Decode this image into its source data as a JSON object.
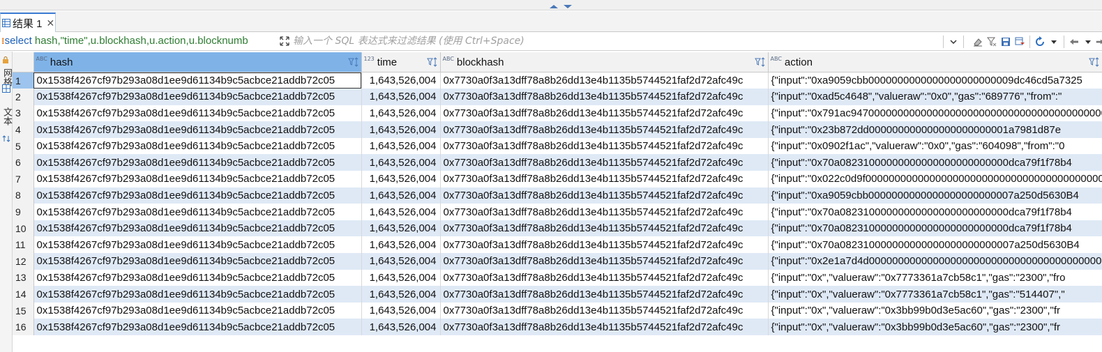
{
  "tab": {
    "label": "结果 1",
    "close": "✕",
    "icon": "grid-icon"
  },
  "filter": {
    "sql_keyword": "select",
    "sql_rest": " hash,\"time\",u.blockhash,u.action,u.blocknumb",
    "placeholder": "输入一个 SQL 表达式来过滤结果 (使用 Ctrl+Space)"
  },
  "side_tabs": [
    "网格",
    "文本"
  ],
  "columns": [
    {
      "name": "hash",
      "type_badge": "ABC"
    },
    {
      "name": "time",
      "type_badge": "123"
    },
    {
      "name": "blockhash",
      "type_badge": "ABC"
    },
    {
      "name": "action",
      "type_badge": "ABC"
    }
  ],
  "rows": [
    {
      "n": "1",
      "hash": "0x1538f4267cf97b293a08d1ee9d61134b9c5acbce21addb72c05",
      "time": "1,643,526,004",
      "blockhash": "0x7730a0f3a13dff78a8b26dd13e4b1135b5744521faf2d72afc49c",
      "action": "{\"input\":\"0xa9059cbb0000000000000000000000009dc46cd5a7325"
    },
    {
      "n": "2",
      "hash": "0x1538f4267cf97b293a08d1ee9d61134b9c5acbce21addb72c05",
      "time": "1,643,526,004",
      "blockhash": "0x7730a0f3a13dff78a8b26dd13e4b1135b5744521faf2d72afc49c",
      "action": "{\"input\":\"0xad5c4648\",\"valueraw\":\"0x0\",\"gas\":\"689776\",\"from\":\""
    },
    {
      "n": "3",
      "hash": "0x1538f4267cf97b293a08d1ee9d61134b9c5acbce21addb72c05",
      "time": "1,643,526,004",
      "blockhash": "0x7730a0f3a13dff78a8b26dd13e4b1135b5744521faf2d72afc49c",
      "action": "{\"input\":\"0x791ac9470000000000000000000000000000000000000000000"
    },
    {
      "n": "4",
      "hash": "0x1538f4267cf97b293a08d1ee9d61134b9c5acbce21addb72c05",
      "time": "1,643,526,004",
      "blockhash": "0x7730a0f3a13dff78a8b26dd13e4b1135b5744521faf2d72afc49c",
      "action": "{\"input\":\"0x23b872dd000000000000000000000001a7981d87e"
    },
    {
      "n": "5",
      "hash": "0x1538f4267cf97b293a08d1ee9d61134b9c5acbce21addb72c05",
      "time": "1,643,526,004",
      "blockhash": "0x7730a0f3a13dff78a8b26dd13e4b1135b5744521faf2d72afc49c",
      "action": "{\"input\":\"0x0902f1ac\",\"valueraw\":\"0x0\",\"gas\":\"604098\",\"from\":\"0"
    },
    {
      "n": "6",
      "hash": "0x1538f4267cf97b293a08d1ee9d61134b9c5acbce21addb72c05",
      "time": "1,643,526,004",
      "blockhash": "0x7730a0f3a13dff78a8b26dd13e4b1135b5744521faf2d72afc49c",
      "action": "{\"input\":\"0x70a08231000000000000000000000000dca79f1f78b4"
    },
    {
      "n": "7",
      "hash": "0x1538f4267cf97b293a08d1ee9d61134b9c5acbce21addb72c05",
      "time": "1,643,526,004",
      "blockhash": "0x7730a0f3a13dff78a8b26dd13e4b1135b5744521faf2d72afc49c",
      "action": "{\"input\":\"0x022c0d9f0000000000000000000000000000000000000000000"
    },
    {
      "n": "8",
      "hash": "0x1538f4267cf97b293a08d1ee9d61134b9c5acbce21addb72c05",
      "time": "1,643,526,004",
      "blockhash": "0x7730a0f3a13dff78a8b26dd13e4b1135b5744521faf2d72afc49c",
      "action": "{\"input\":\"0xa9059cbb0000000000000000000000007a250d5630B4"
    },
    {
      "n": "9",
      "hash": "0x1538f4267cf97b293a08d1ee9d61134b9c5acbce21addb72c05",
      "time": "1,643,526,004",
      "blockhash": "0x7730a0f3a13dff78a8b26dd13e4b1135b5744521faf2d72afc49c",
      "action": "{\"input\":\"0x70a08231000000000000000000000000dca79f1f78b4"
    },
    {
      "n": "10",
      "hash": "0x1538f4267cf97b293a08d1ee9d61134b9c5acbce21addb72c05",
      "time": "1,643,526,004",
      "blockhash": "0x7730a0f3a13dff78a8b26dd13e4b1135b5744521faf2d72afc49c",
      "action": "{\"input\":\"0x70a08231000000000000000000000000dca79f1f78b4"
    },
    {
      "n": "11",
      "hash": "0x1538f4267cf97b293a08d1ee9d61134b9c5acbce21addb72c05",
      "time": "1,643,526,004",
      "blockhash": "0x7730a0f3a13dff78a8b26dd13e4b1135b5744521faf2d72afc49c",
      "action": "{\"input\":\"0x70a082310000000000000000000000007a250d5630B4"
    },
    {
      "n": "12",
      "hash": "0x1538f4267cf97b293a08d1ee9d61134b9c5acbce21addb72c05",
      "time": "1,643,526,004",
      "blockhash": "0x7730a0f3a13dff78a8b26dd13e4b1135b5744521faf2d72afc49c",
      "action": "{\"input\":\"0x2e1a7d4d0000000000000000000000000000000000000000000"
    },
    {
      "n": "13",
      "hash": "0x1538f4267cf97b293a08d1ee9d61134b9c5acbce21addb72c05",
      "time": "1,643,526,004",
      "blockhash": "0x7730a0f3a13dff78a8b26dd13e4b1135b5744521faf2d72afc49c",
      "action": "{\"input\":\"0x\",\"valueraw\":\"0x7773361a7cb58c1\",\"gas\":\"2300\",\"fro"
    },
    {
      "n": "14",
      "hash": "0x1538f4267cf97b293a08d1ee9d61134b9c5acbce21addb72c05",
      "time": "1,643,526,004",
      "blockhash": "0x7730a0f3a13dff78a8b26dd13e4b1135b5744521faf2d72afc49c",
      "action": "{\"input\":\"0x\",\"valueraw\":\"0x7773361a7cb58c1\",\"gas\":\"514407\",\""
    },
    {
      "n": "15",
      "hash": "0x1538f4267cf97b293a08d1ee9d61134b9c5acbce21addb72c05",
      "time": "1,643,526,004",
      "blockhash": "0x7730a0f3a13dff78a8b26dd13e4b1135b5744521faf2d72afc49c",
      "action": "{\"input\":\"0x\",\"valueraw\":\"0x3bb99b0d3e5ac60\",\"gas\":\"2300\",\"fr"
    },
    {
      "n": "16",
      "hash": "0x1538f4267cf97b293a08d1ee9d61134b9c5acbce21addb72c05",
      "time": "1,643,526,004",
      "blockhash": "0x7730a0f3a13dff78a8b26dd13e4b1135b5744521faf2d72afc49c",
      "action": "{\"input\":\"0x\",\"valueraw\":\"0x3bb99b0d3e5ac60\",\"gas\":\"2300\",\"fr"
    }
  ],
  "colors": {
    "selected_header": "#7fb3e8",
    "stripe": "#dfe9f6",
    "tab_accent": "#3b7bd4",
    "sql_text": "#2e7d32"
  }
}
